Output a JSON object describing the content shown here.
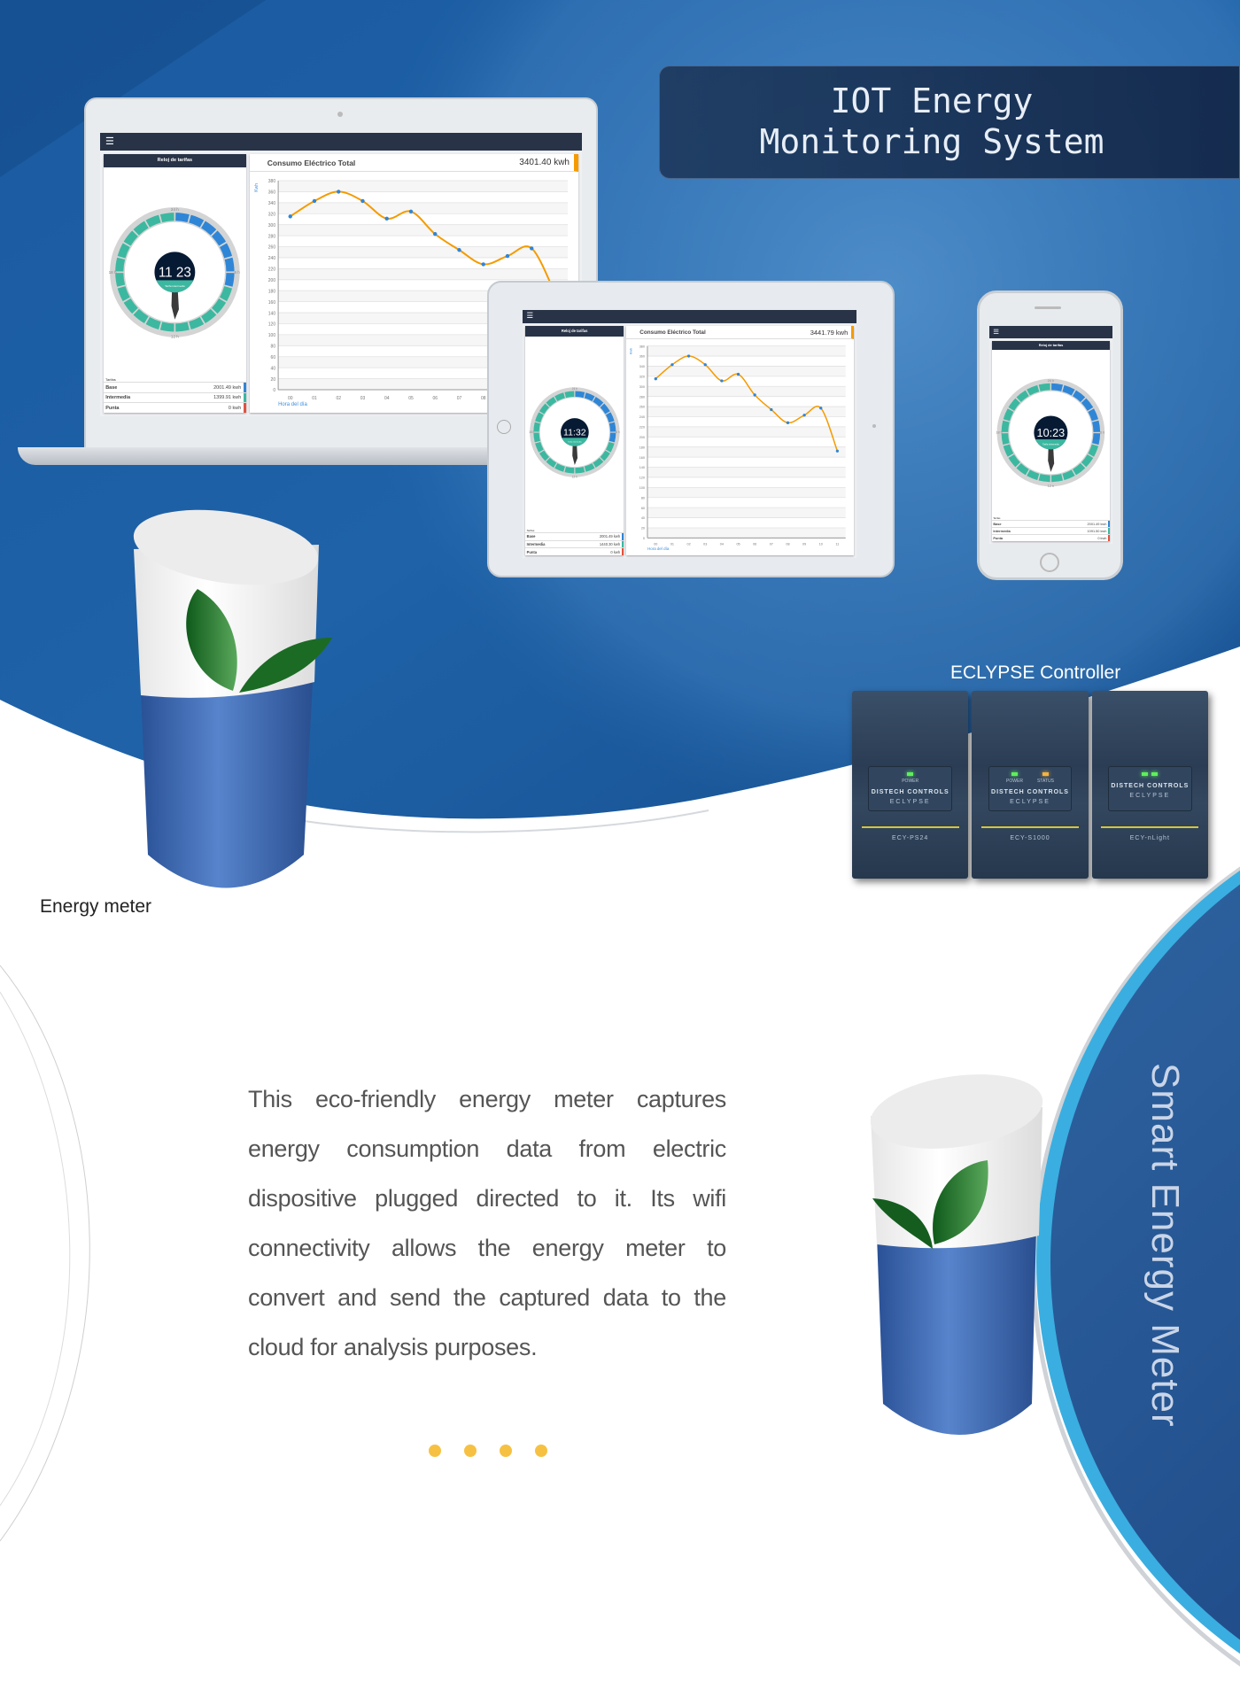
{
  "header": {
    "title_lines": [
      "IOT Energy",
      "Monitoring System"
    ]
  },
  "dashboard": {
    "clock_title": "Reloj de tarifas",
    "clock_badge": "Tarifa intermedia",
    "hour_labels": [
      "24 h",
      "6 h",
      "12 h",
      "18 h"
    ],
    "tariffs_label": "Tarifas",
    "chart_title": "Consumo Eléctrico Total",
    "y_unit": "Kwh",
    "x_label": "Hora del día"
  },
  "devices": {
    "laptop": {
      "clock_time": "11 23",
      "total": "3401.40 kwh",
      "tariffs": [
        {
          "name": "Base",
          "value": "2001.49 kwh"
        },
        {
          "name": "Intermedia",
          "value": "1399.91 kwh"
        },
        {
          "name": "Punta",
          "value": "0 kwh"
        }
      ]
    },
    "tablet": {
      "clock_time": "11:32",
      "total": "3441.79 kwh",
      "tariffs": [
        {
          "name": "Base",
          "value": "2001.49 kwh"
        },
        {
          "name": "Intermedia",
          "value": "1440.30 kwh"
        },
        {
          "name": "Punta",
          "value": "0 kwh"
        }
      ]
    },
    "phone": {
      "clock_time": "10:23",
      "tariffs": [
        {
          "name": "Base",
          "value": "2001.49 kwh"
        },
        {
          "name": "Intermedia",
          "value": "1091.50 kwh"
        },
        {
          "name": "Punta",
          "value": "0 kwh"
        }
      ]
    }
  },
  "tariff_colors": [
    "#2f86d6",
    "#3cb8a0",
    "#e0533f"
  ],
  "chart_data": {
    "type": "line",
    "title": "Consumo Eléctrico Total",
    "xlabel": "Hora del día",
    "ylabel": "Kwh",
    "x": [
      "00",
      "01",
      "02",
      "03",
      "04",
      "05",
      "06",
      "07",
      "08",
      "09",
      "10",
      "11"
    ],
    "values": [
      315,
      343,
      360,
      343,
      311,
      324,
      283,
      254,
      228,
      243,
      257,
      172
    ],
    "ylim": [
      0,
      380
    ],
    "ytick_step": 20,
    "line_color": "#f59b00",
    "point_color": "#2f86d6",
    "grid": true
  },
  "labels": {
    "energy_meter": "Energy meter",
    "controller": "ECLYPSE Controller",
    "smart_meter": "Smart Energy Meter"
  },
  "controller": {
    "brand": "DISTECH CONTROLS",
    "product": "ECLYPSE",
    "modules": [
      {
        "model": "ECY-PS24",
        "leds": [
          "POWER"
        ]
      },
      {
        "model": "ECY-S1000",
        "leds": [
          "POWER",
          "STATUS"
        ]
      },
      {
        "model": "ECY-nLight",
        "leds": []
      }
    ]
  },
  "description": {
    "lines": [
      "This eco-friendly energy meter captures",
      "energy consumption data from electric",
      "dispositive plugged directed to it. Its wifi",
      "connectivity allows the energy meter to",
      "convert and send the captured data to the",
      "cloud for analysis purposes."
    ]
  },
  "pagination": {
    "count": 4
  }
}
